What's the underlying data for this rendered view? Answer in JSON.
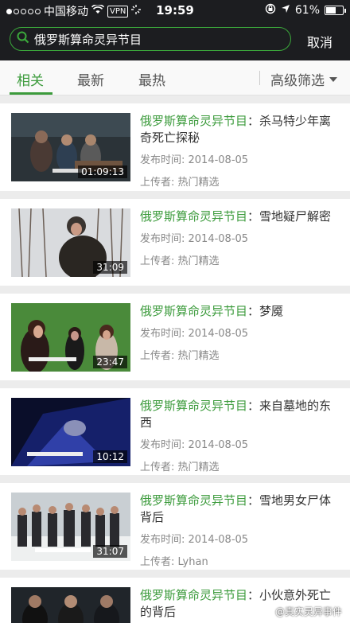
{
  "status": {
    "carrier": "中国移动",
    "vpn": "VPN",
    "time": "19:59",
    "battery": "61%",
    "battery_level": 0.61
  },
  "search": {
    "query": "俄罗斯算命灵异节目",
    "cancel_label": "取消"
  },
  "tabs": {
    "items": [
      "相关",
      "最新",
      "最热"
    ],
    "active_index": 0,
    "filter_label": "高级筛选"
  },
  "results": [
    {
      "highlight": "俄罗斯算命灵异节目",
      "rest": "：杀马特少年离奇死亡探秘",
      "date_label": "发布时间: 2014-08-05",
      "uploader_label": "上传者: 热门精选",
      "duration": "01:09:13"
    },
    {
      "highlight": "俄罗斯算命灵异节目",
      "rest": "：雪地疑尸解密",
      "date_label": "发布时间: 2014-08-05",
      "uploader_label": "上传者: 热门精选",
      "duration": "31:09"
    },
    {
      "highlight": "俄罗斯算命灵异节目",
      "rest": "：梦魇",
      "date_label": "发布时间: 2014-08-05",
      "uploader_label": "上传者: 热门精选",
      "duration": "23:47"
    },
    {
      "highlight": "俄罗斯算命灵异节目",
      "rest": "：来自墓地的东西",
      "date_label": "发布时间: 2014-08-05",
      "uploader_label": "上传者: 热门精选",
      "duration": "10:12"
    },
    {
      "highlight": "俄罗斯算命灵异节目",
      "rest": "：雪地男女尸体背后",
      "date_label": "发布时间: 2014-08-05",
      "uploader_label": "上传者: Lyhan",
      "duration": "31:07"
    },
    {
      "highlight": "俄罗斯算命灵异节目",
      "rest": "：小伙意外死亡的背后",
      "date_label": "",
      "uploader_label": "",
      "duration": ""
    }
  ],
  "watermark": "@真实灵异事件",
  "colors": {
    "accent": "#3c9b3c",
    "header_bg": "#1c1d20"
  }
}
